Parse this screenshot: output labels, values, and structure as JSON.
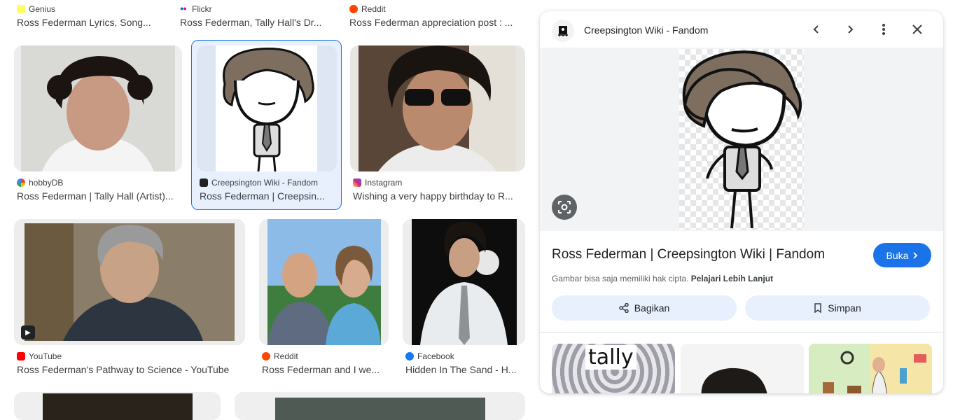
{
  "grid": {
    "row0": [
      {
        "source": "Genius",
        "caption": "Ross Federman Lyrics, Song..."
      },
      {
        "source": "Flickr",
        "caption": "Ross Federman, Tally Hall's Dr..."
      },
      {
        "source": "Reddit",
        "caption": "Ross Federman appreciation post : ..."
      }
    ],
    "row1": [
      {
        "source": "hobbyDB",
        "caption": "Ross Federman | Tally Hall (Artist)..."
      },
      {
        "source": "Creepsington Wiki - Fandom",
        "caption": "Ross Federman | Creepsin..."
      },
      {
        "source": "Instagram",
        "caption": "Wishing a very happy birthday to R..."
      }
    ],
    "row2": [
      {
        "source": "YouTube",
        "caption": "Ross Federman's Pathway to Science - YouTube"
      },
      {
        "source": "Reddit",
        "caption": "Ross Federman and I we..."
      },
      {
        "source": "Facebook",
        "caption": "Hidden In The Sand - H..."
      }
    ]
  },
  "panel": {
    "site": "Creepsington Wiki - Fandom",
    "title": "Ross Federman | Creepsington Wiki | Fandom",
    "open_label": "Buka",
    "notice_text": "Gambar bisa saja memiliki hak cipta.",
    "notice_link": "Pelajari Lebih Lanjut",
    "share_label": "Bagikan",
    "save_label": "Simpan",
    "related_text": "tally"
  },
  "colors": {
    "accent": "#1a73e8",
    "selected_bg": "#e8f0fe"
  }
}
